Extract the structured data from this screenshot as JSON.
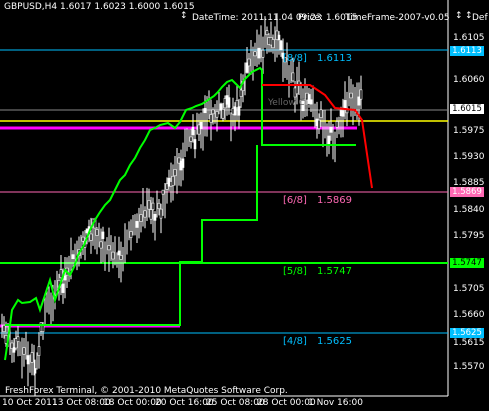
{
  "header": {
    "symbol_info": "GBPUSD,H4  1.6017 1.6023 1.6000 1.6015",
    "datetime": "DateTime: 2011.11.04 09:23",
    "price": "Price: 1.6015",
    "timeframe": "TimeFrame-2007-v0.05",
    "def_stub": "Def",
    "buttons": [
      "↕",
      "↕",
      "↕"
    ]
  },
  "footer": "FreshForex Terminal, © 2001-2010 MetaQuotes Software Corp.",
  "x_axis": [
    "10 Oct 2011",
    "13 Oct 08:00",
    "18 Oct 00:00",
    "20 Oct 16:00",
    "25 Oct 08:00",
    "28 Oct 00:00",
    "1 Nov 16:00"
  ],
  "y_axis": [
    "1.6105",
    "1.6060",
    "1.6015",
    "1.5975",
    "1.5930",
    "1.5885",
    "1.5840",
    "1.5795",
    "1.5750",
    "1.5705",
    "1.5660",
    "1.5615",
    "1.5570"
  ],
  "price_boxes": [
    {
      "text": "1.6113",
      "color": "#00bfff"
    },
    {
      "text": "1.6015",
      "color": "#ffffff"
    },
    {
      "text": "1.5869",
      "color": "#ff69b4"
    },
    {
      "text": "1.5747",
      "color": "#00ff00"
    },
    {
      "text": "1.5625",
      "color": "#00bfff"
    }
  ],
  "murrey_labels": [
    {
      "tag": "[8/8]",
      "value": "1.6113",
      "color": "#00bfff"
    },
    {
      "tag": "[6/8]",
      "value": "1.5869",
      "color": "#ff69b4"
    },
    {
      "tag": "[5/8]",
      "value": "1.5747",
      "color": "#00ff00"
    },
    {
      "tag": "[4/8]",
      "value": "1.5625",
      "color": "#00bfff"
    }
  ],
  "overlay_text": "Yellow Cl.",
  "colors": {
    "background": "#000000",
    "candles": "#ffffff",
    "green_line": "#00ff00",
    "magenta_line": "#ff00ff",
    "yellow_line": "#ffff00",
    "red_line": "#ff0000",
    "blue_level": "#00bfff",
    "pink_level": "#ff69b4"
  }
}
